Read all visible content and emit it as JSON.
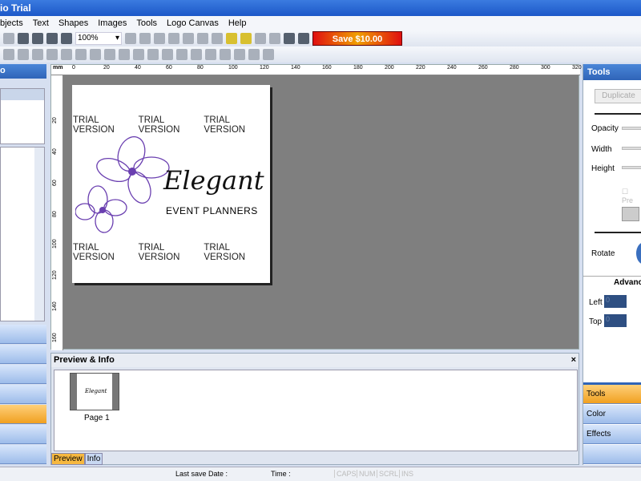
{
  "window": {
    "title": "io Trial"
  },
  "menu": [
    "bjects",
    "Text",
    "Shapes",
    "Images",
    "Tools",
    "Logo Canvas",
    "Help"
  ],
  "toolbar": {
    "zoom_value": "100%",
    "save_label": "Save $10.00"
  },
  "left_panel": {
    "header": "o"
  },
  "ruler": {
    "unit": "mm",
    "top": [
      "0",
      "20",
      "40",
      "60",
      "80",
      "100",
      "120",
      "140",
      "160",
      "180",
      "200",
      "220",
      "240",
      "260",
      "280",
      "300",
      "320"
    ],
    "left": [
      "20",
      "40",
      "60",
      "80",
      "100",
      "120",
      "140",
      "160"
    ]
  },
  "canvas": {
    "trial": "TRIAL VERSION",
    "logo_title": "Elegant",
    "logo_subtitle": "EVENT PLANNERS",
    "accent": "#6a3fb0"
  },
  "preview": {
    "title": "Preview & Info",
    "close": "×",
    "thumb_text": "Elegant",
    "page_label": "Page 1",
    "tabs": [
      "Preview",
      "Info"
    ]
  },
  "tools_panel": {
    "title": "Tools",
    "duplicate": "Duplicate",
    "opacity": "Opacity",
    "width": "Width",
    "height": "Height",
    "pre": "Pre",
    "rotate": "Rotate",
    "advanced": "Advanc",
    "left": "Left",
    "left_value": "0",
    "top": "Top",
    "top_value": "0",
    "buttons": [
      "Tools",
      "Color",
      "Effects"
    ]
  },
  "status": {
    "last_save": "Last save Date :",
    "time": "Time :",
    "indicators": [
      "CAPS",
      "NUM",
      "SCRL",
      "INS"
    ]
  }
}
